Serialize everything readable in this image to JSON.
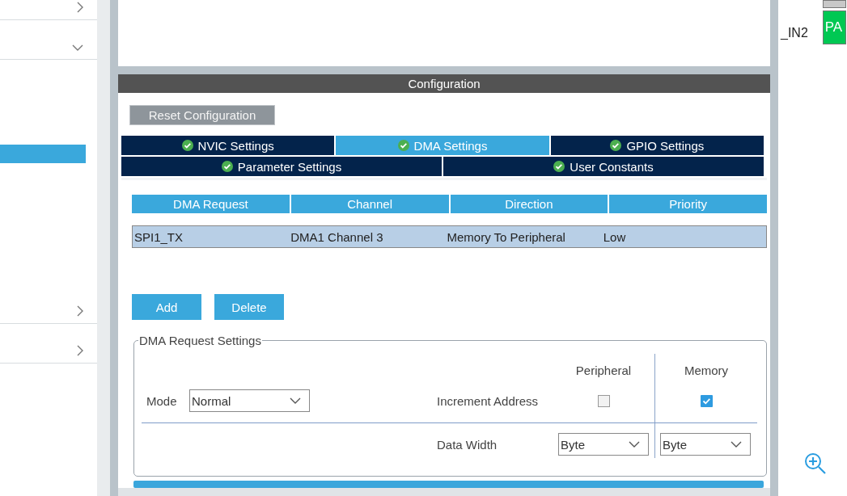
{
  "sidebar": {
    "items": [
      {
        "kind": "group",
        "expanded": false
      },
      {
        "kind": "group",
        "expanded": true
      },
      {
        "kind": "row",
        "selected": true
      },
      {
        "kind": "group",
        "expanded": false
      },
      {
        "kind": "group",
        "expanded": false
      }
    ]
  },
  "configuration": {
    "title": "Configuration",
    "reset_button": "Reset Configuration",
    "tab_rows": [
      [
        {
          "label": "NVIC Settings",
          "selected": false,
          "valid": true
        },
        {
          "label": "DMA Settings",
          "selected": true,
          "valid": true
        },
        {
          "label": "GPIO Settings",
          "selected": false,
          "valid": true
        }
      ],
      [
        {
          "label": "Parameter Settings",
          "selected": false,
          "valid": true
        },
        {
          "label": "User Constants",
          "selected": false,
          "valid": true
        }
      ]
    ],
    "table": {
      "columns": [
        "DMA Request",
        "Channel",
        "Direction",
        "Priority"
      ],
      "rows": [
        {
          "cells": [
            "SPI1_TX",
            "DMA1 Channel 3",
            "Memory To Peripheral",
            "Low"
          ],
          "selected": true
        }
      ]
    },
    "buttons": [
      "Add",
      "Delete"
    ],
    "request_settings": {
      "title": "DMA Request Settings",
      "columns": [
        "Peripheral",
        "Memory"
      ],
      "mode": {
        "label": "Mode",
        "value": "Normal"
      },
      "increment_address": {
        "label": "Increment Address",
        "peripheral": false,
        "memory": true
      },
      "data_width": {
        "label": "Data Width",
        "peripheral": "Byte",
        "memory": "Byte"
      }
    }
  },
  "pinout": {
    "label": "_IN2",
    "pins": [
      {
        "color": "#c8c8c8"
      },
      {
        "label": "PA",
        "color": "#00c853"
      }
    ]
  }
}
